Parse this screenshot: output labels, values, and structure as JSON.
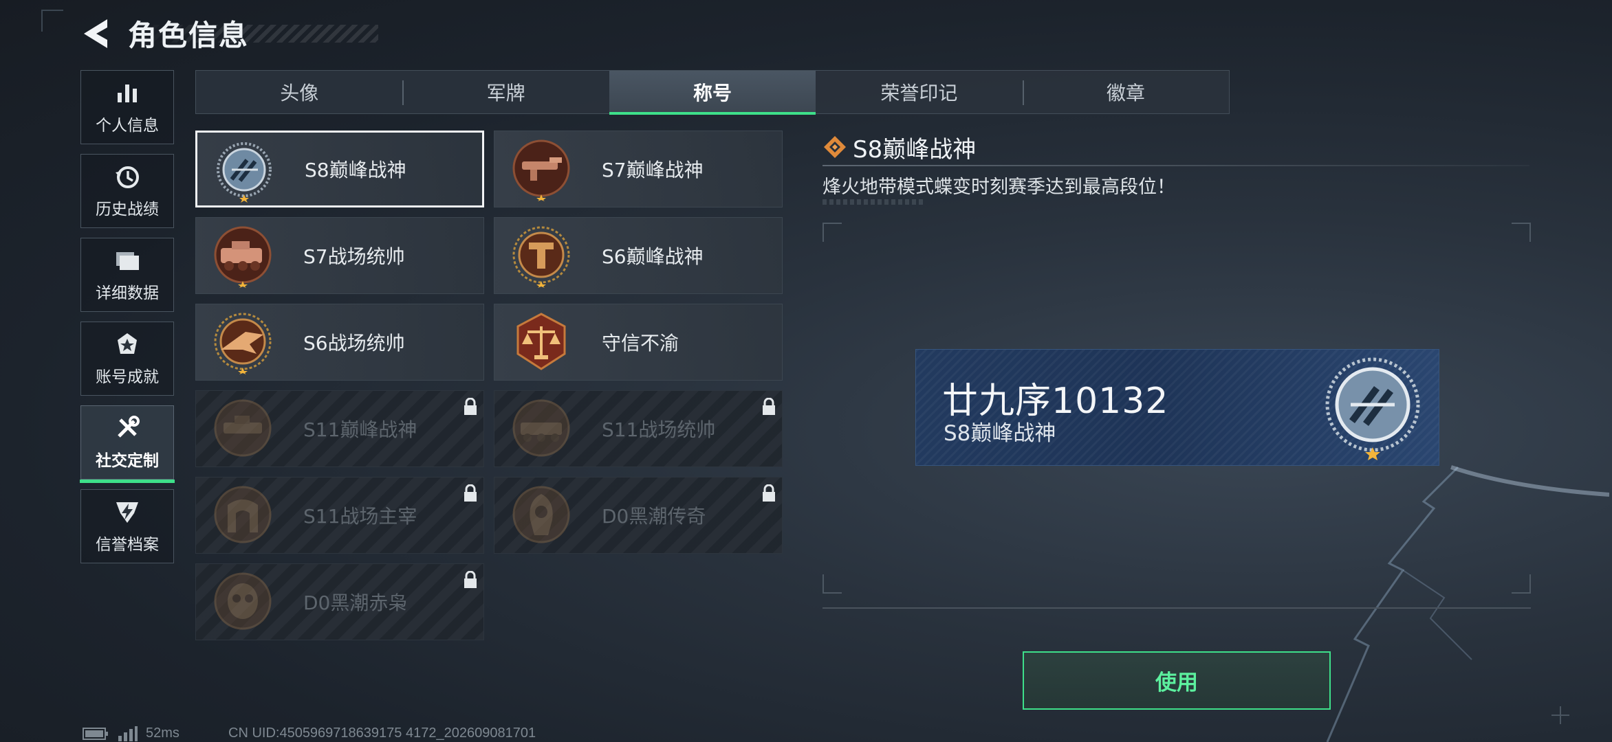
{
  "header": {
    "title": "角色信息"
  },
  "sidebar": {
    "items": [
      {
        "label": "个人信息",
        "icon": "bar-chart-icon"
      },
      {
        "label": "历史战绩",
        "icon": "history-clock-icon"
      },
      {
        "label": "详细数据",
        "icon": "folder-icon"
      },
      {
        "label": "账号成就",
        "icon": "achievement-icon"
      },
      {
        "label": "社交定制",
        "icon": "tools-icon",
        "active": true
      },
      {
        "label": "信誉档案",
        "icon": "credit-shield-icon"
      }
    ]
  },
  "tabs": [
    {
      "label": "头像"
    },
    {
      "label": "军牌"
    },
    {
      "label": "称号",
      "active": true
    },
    {
      "label": "荣誉印记"
    },
    {
      "label": "徽章"
    }
  ],
  "titles": [
    {
      "name": "S8巅峰战神",
      "locked": false,
      "selected": true,
      "icon": "s8-peak-emblem-icon"
    },
    {
      "name": "S7巅峰战神",
      "locked": false,
      "icon": "s7-peak-emblem-icon"
    },
    {
      "name": "S7战场统帅",
      "locked": false,
      "icon": "s7-commander-emblem-icon"
    },
    {
      "name": "S6巅峰战神",
      "locked": false,
      "icon": "s6-peak-emblem-icon"
    },
    {
      "name": "S6战场统帅",
      "locked": false,
      "icon": "s6-commander-emblem-icon"
    },
    {
      "name": "守信不渝",
      "locked": false,
      "icon": "scales-emblem-icon"
    },
    {
      "name": "S11巅峰战神",
      "locked": true,
      "icon": "s11-peak-emblem-icon"
    },
    {
      "name": "S11战场统帅",
      "locked": true,
      "icon": "s11-commander-emblem-icon"
    },
    {
      "name": "S11战场主宰",
      "locked": true,
      "icon": "s11-dominator-emblem-icon"
    },
    {
      "name": "D0黑潮传奇",
      "locked": true,
      "icon": "d0-legend-emblem-icon"
    },
    {
      "name": "D0黑潮赤枭",
      "locked": true,
      "icon": "d0-owl-emblem-icon"
    }
  ],
  "detail": {
    "title": "S8巅峰战神",
    "description": "烽火地带模式蝶变时刻赛季达到最高段位！"
  },
  "preview": {
    "player_name": "廿九序10132",
    "title": "S8巅峰战神"
  },
  "use_button": {
    "label": "使用"
  },
  "status": {
    "ping": "52ms",
    "uid": "CN UID:4505969718639175 4172_202609081701"
  },
  "colors": {
    "accent_green": "#3ee08a",
    "preview_blue": "#223a5f",
    "bronze": "#8a4a2a"
  }
}
